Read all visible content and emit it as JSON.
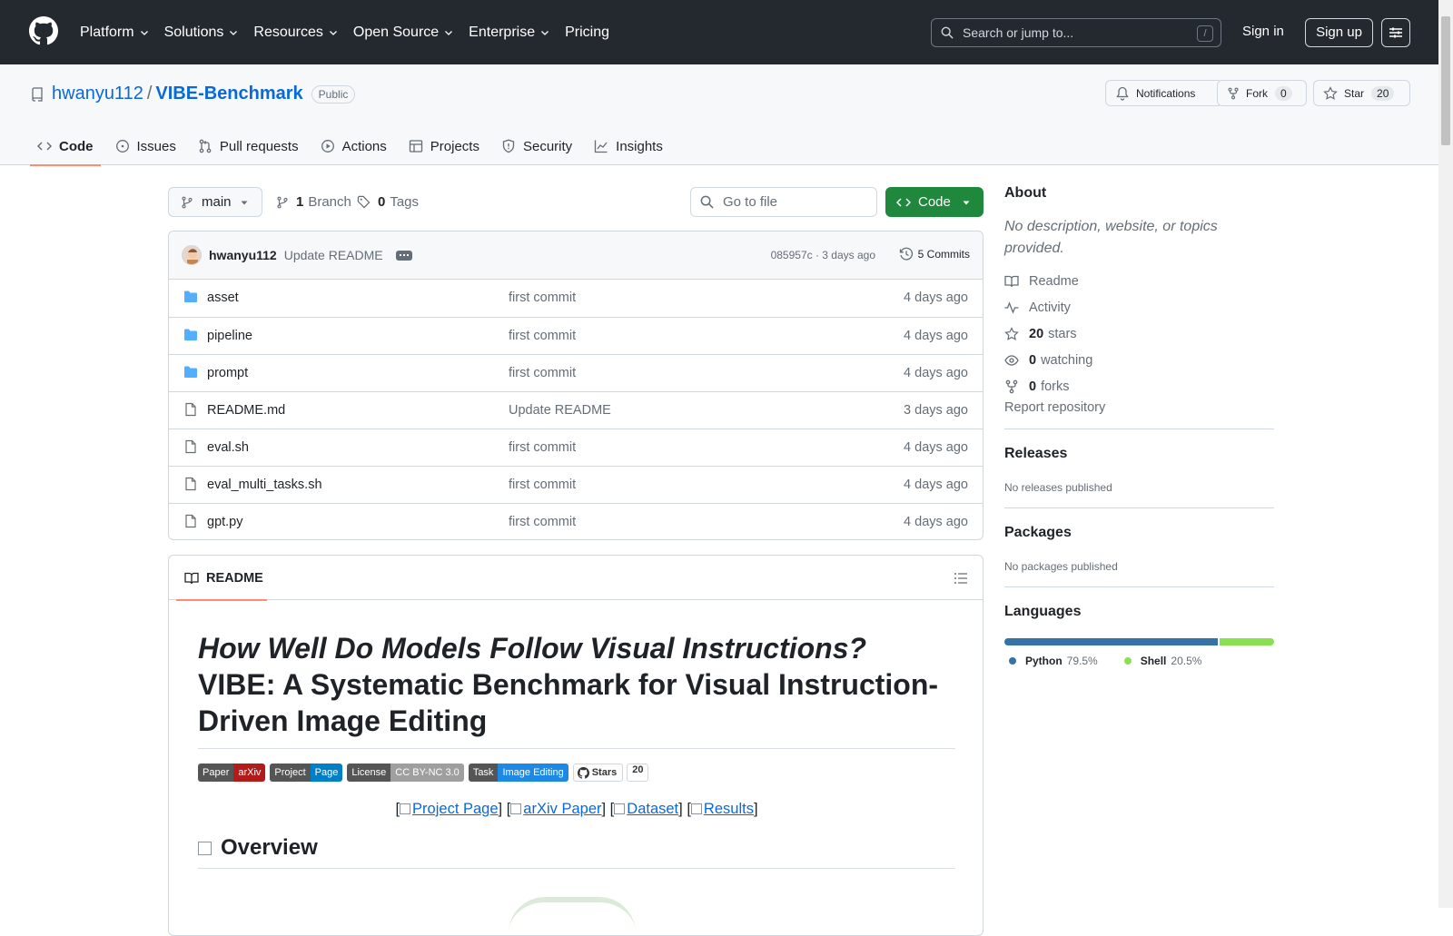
{
  "global_nav": {
    "items": [
      "Platform",
      "Solutions",
      "Resources",
      "Open Source",
      "Enterprise",
      "Pricing"
    ],
    "search_placeholder": "Search or jump to...",
    "search_shortcut": "/",
    "sign_in": "Sign in",
    "sign_up": "Sign up"
  },
  "repo": {
    "owner": "hwanyu112",
    "separator": "/",
    "name": "VIBE-Benchmark",
    "visibility": "Public",
    "notifications_label": "Notifications",
    "fork_label": "Fork",
    "fork_count": "0",
    "star_label": "Star",
    "star_count": "20"
  },
  "tabs": [
    "Code",
    "Issues",
    "Pull requests",
    "Actions",
    "Projects",
    "Security",
    "Insights"
  ],
  "toolbar": {
    "branch": "main",
    "branch_count": "1",
    "branch_label": "Branch",
    "tag_count": "0",
    "tag_label": "Tags",
    "go_to_file": "Go to file",
    "code_button": "Code"
  },
  "commit": {
    "author": "hwanyu112",
    "message": "Update README",
    "hash_time": "085957c · 3 days ago",
    "commits": "5 Commits"
  },
  "files": [
    {
      "type": "dir",
      "name": "asset",
      "message": "first commit",
      "date": "4 days ago"
    },
    {
      "type": "dir",
      "name": "pipeline",
      "message": "first commit",
      "date": "4 days ago"
    },
    {
      "type": "dir",
      "name": "prompt",
      "message": "first commit",
      "date": "4 days ago"
    },
    {
      "type": "file",
      "name": "README.md",
      "message": "Update README",
      "date": "3 days ago"
    },
    {
      "type": "file",
      "name": "eval.sh",
      "message": "first commit",
      "date": "4 days ago"
    },
    {
      "type": "file",
      "name": "eval_multi_tasks.sh",
      "message": "first commit",
      "date": "4 days ago"
    },
    {
      "type": "file",
      "name": "gpt.py",
      "message": "first commit",
      "date": "4 days ago"
    }
  ],
  "readme": {
    "tab": "README",
    "title_italic": "How Well Do Models Follow Visual Instructions?",
    "title_rest": "VIBE: A Systematic Benchmark for Visual Instruction-Driven Image Editing",
    "badges": [
      {
        "left": "Paper",
        "right": "arXiv",
        "color": "#b31b1b"
      },
      {
        "left": "Project",
        "right": "Page",
        "color": "#007ec6"
      },
      {
        "left": "License",
        "right": "CC BY-NC 3.0",
        "color": "#9f9f9f"
      },
      {
        "left": "Task",
        "right": "Image Editing",
        "color": "#1e88e5"
      }
    ],
    "stars_badge_label": "Stars",
    "stars_badge_count": "20",
    "links": [
      "Project Page",
      "arXiv Paper",
      "Dataset",
      "Results"
    ],
    "overview_heading": "Overview"
  },
  "about": {
    "heading": "About",
    "description": "No description, website, or topics provided.",
    "readme": "Readme",
    "activity": "Activity",
    "stars_count": "20",
    "stars_label": "stars",
    "watching_count": "0",
    "watching_label": "watching",
    "forks_count": "0",
    "forks_label": "forks",
    "report": "Report repository"
  },
  "releases": {
    "heading": "Releases",
    "text": "No releases published"
  },
  "packages": {
    "heading": "Packages",
    "text": "No packages published"
  },
  "languages": {
    "heading": "Languages",
    "items": [
      {
        "name": "Python",
        "percent": "79.5%",
        "value": 79.5,
        "color": "#3572A5"
      },
      {
        "name": "Shell",
        "percent": "20.5%",
        "value": 20.5,
        "color": "#89e051"
      }
    ]
  }
}
